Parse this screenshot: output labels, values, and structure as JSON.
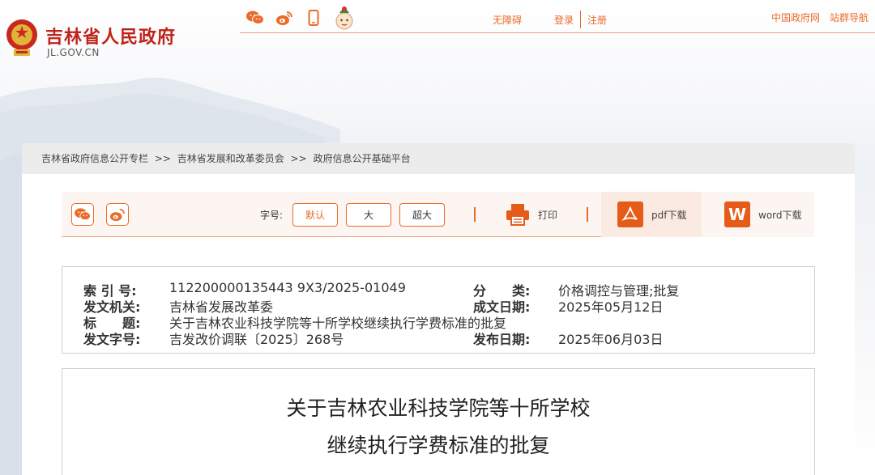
{
  "site": {
    "name": "吉林省人民政府",
    "domain": "JL.GOV.CN"
  },
  "top_nav": {
    "accessibility": "无障碍",
    "login": "登录",
    "register": "注册",
    "gov_portal": "中国政府网",
    "site_map": "站群导航",
    "icons": [
      "wechat-icon",
      "weibo-icon",
      "mobile-icon",
      "mascot-icon"
    ]
  },
  "breadcrumb": {
    "items": [
      "吉林省政府信息公开专栏",
      "吉林省发展和改革委员会",
      "政府信息公开基础平台"
    ],
    "separator": ">>"
  },
  "toolbar": {
    "font_size_label": "字号:",
    "font_sizes": [
      "默认",
      "大",
      "超大"
    ],
    "print_label": "打印",
    "pdf_label": "pdf下载",
    "word_label": "word下载",
    "word_badge": "W",
    "share_icons": [
      "wechat-share-icon",
      "weibo-share-icon"
    ]
  },
  "meta": {
    "index_label": "索 引 号:",
    "index_value": "112200000135443 9X3/2025-01049",
    "category_label": "分　　类:",
    "category_value": "价格调控与管理;批复",
    "issuer_label": "发文机关:",
    "issuer_value": "吉林省发展改革委",
    "written_date_label": "成文日期:",
    "written_date_value": "2025年05月12日",
    "title_label": "标　　题:",
    "title_value": "关于吉林农业科技学院等十所学校继续执行学费标准的批复",
    "doc_no_label": "发文字号:",
    "doc_no_value": "吉发改价调联〔2025〕268号",
    "publish_date_label": "发布日期:",
    "publish_date_value": "2025年06月03日"
  },
  "article": {
    "title_line1": "关于吉林农业科技学院等十所学校",
    "title_line2": "继续执行学费标准的批复"
  },
  "colors": {
    "accent": "#e96b2a",
    "brand_red": "#c0231b",
    "toolbar_bg": "#fdf5f1",
    "breadcrumb_bg": "#ececec"
  }
}
